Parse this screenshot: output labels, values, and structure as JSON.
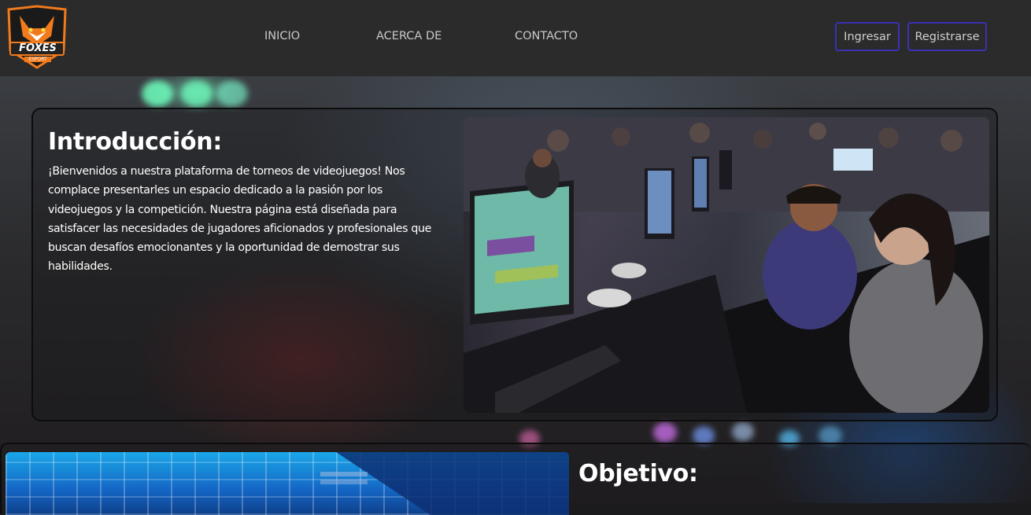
{
  "header": {
    "logo_text": "FOXES",
    "logo_subtext": "ESPORT",
    "nav": [
      {
        "label": "INICIO"
      },
      {
        "label": "ACERCA DE"
      },
      {
        "label": "CONTACTO"
      }
    ],
    "login_label": "Ingresar",
    "register_label": "Registrarse"
  },
  "intro": {
    "title": "Introducción:",
    "text": "¡Bienvenidos a nuestra plataforma de torneos de videojuegos! Nos complace presentarles un espacio dedicado a la pasión por los videojuegos y la competición. Nuestra página está diseñada para satisfacer las necesidades de jugadores aficionados y profesionales que buscan desafíos emocionantes y la oportunidad de demostrar sus habilidades.",
    "image_icon": "esports-tournament-photo"
  },
  "objective": {
    "title": "Objetivo:",
    "image_icon": "arena-photo"
  },
  "colors": {
    "header_bg": "#2b2b2b",
    "button_border": "#3a31b3",
    "nav_text": "#c9c9c9",
    "logo_orange": "#f07a1c"
  }
}
